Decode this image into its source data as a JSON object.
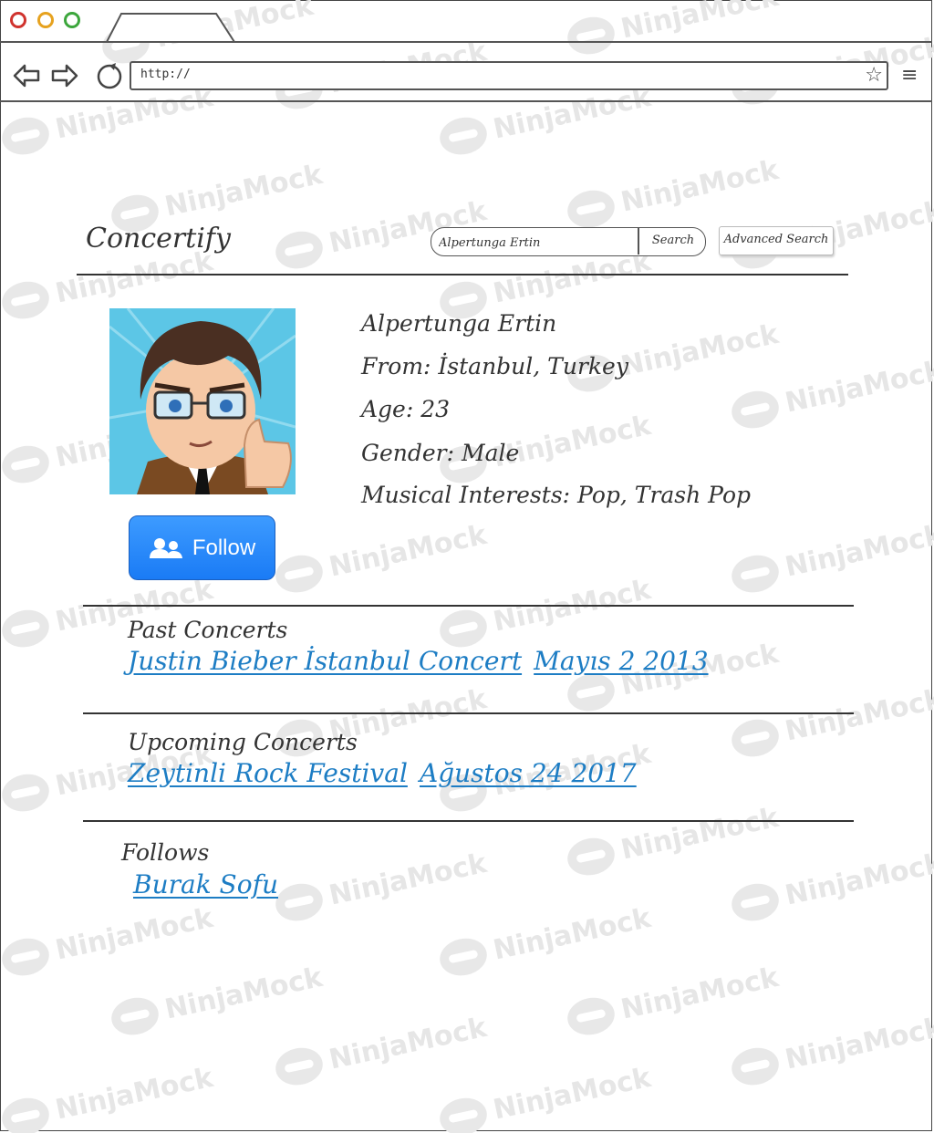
{
  "browser": {
    "url": "http://"
  },
  "header": {
    "brand": "Concertify",
    "search_value": "Alpertunga Ertin",
    "search_button": "Search",
    "advanced_search_button": "Advanced Search"
  },
  "profile": {
    "name": "Alpertunga Ertin",
    "from": "From: İstanbul, Turkey",
    "age": "Age:  23",
    "gender": "Gender: Male",
    "interests": "Musical Interests: Pop, Trash Pop",
    "follow_button": "Follow"
  },
  "past_concerts": {
    "title": "Past Concerts",
    "event": "Justin Bieber İstanbul Concert",
    "date": "Mayıs 2 2013"
  },
  "upcoming_concerts": {
    "title": "Upcoming Concerts",
    "event": "Zeytinli Rock Festival",
    "date": "Ağustos 24 2017"
  },
  "follows": {
    "title": "Follows",
    "user": "Burak Sofu"
  },
  "watermark": "NinjaMock",
  "colors": {
    "follow_button": "#2a88ff",
    "link": "#1d7dc4",
    "dot_red": "#d0332e",
    "dot_yellow": "#e6a21f",
    "dot_green": "#3ca63c"
  }
}
